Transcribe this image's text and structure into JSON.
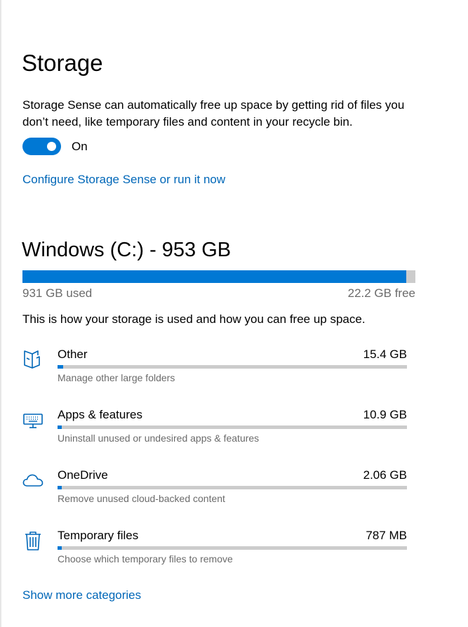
{
  "page": {
    "title": "Storage"
  },
  "storage_sense": {
    "description": "Storage Sense can automatically free up space by getting rid of files you don’t need, like temporary files and content in your recycle bin.",
    "toggle_state": "On",
    "configure_link": "Configure Storage Sense or run it now"
  },
  "drive": {
    "title": "Windows (C:) - 953 GB",
    "used_label": "931 GB used",
    "free_label": "22.2 GB free",
    "used_fraction": 0.977,
    "info": "This is how your storage is used and how you can free up space."
  },
  "categories": [
    {
      "name": "Other",
      "size": "15.4 GB",
      "sub": "Manage other large folders",
      "fraction": 0.0165,
      "icon": "folder-icon"
    },
    {
      "name": "Apps & features",
      "size": "10.9 GB",
      "sub": "Uninstall unused or undesired apps & features",
      "fraction": 0.0117,
      "icon": "keyboard-icon"
    },
    {
      "name": "OneDrive",
      "size": "2.06 GB",
      "sub": "Remove unused cloud-backed content",
      "fraction": 0.0022,
      "icon": "cloud-icon"
    },
    {
      "name": "Temporary files",
      "size": "787 MB",
      "sub": "Choose which temporary files to remove",
      "fraction": 0.0008,
      "icon": "trash-icon"
    }
  ],
  "show_more_link": "Show more categories",
  "colors": {
    "accent": "#0078d4",
    "link": "#0067b8",
    "track": "#cccccc",
    "secondary_text": "#6b6b6b"
  }
}
